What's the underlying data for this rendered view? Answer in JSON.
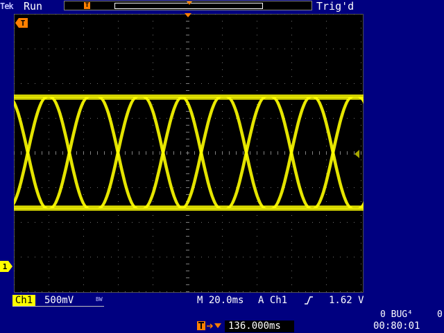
{
  "header": {
    "brand": "Tek",
    "run_state": "Run",
    "trigger_state": "Trig'd",
    "record_trigger_mark": "T"
  },
  "screen": {
    "trigger_marker": "T"
  },
  "channel": {
    "label": "Ch1",
    "ground_marker": "1",
    "scale": "500mV",
    "bandwidth_limit": "BW",
    "color": "#ffff00"
  },
  "horizontal": {
    "timebase": "M 20.0ms",
    "delay": "136.000ms"
  },
  "trigger": {
    "prefix": "A",
    "source": "Ch1",
    "level": "1.62 V"
  },
  "status": {
    "line1": "0 BUG⁴",
    "line1_right": "0",
    "clock": "00:80:01"
  },
  "colors": {
    "background": "#000080",
    "screen": "#000000",
    "trace": "#ffff00",
    "marker": "#ff7f00"
  },
  "waveform": {
    "type": "eye-diagram",
    "high_level_div": 1.6,
    "low_level_div": -1.6,
    "crossings_div": [
      -5.8,
      -4.6,
      -3.4,
      -2.0,
      -0.7,
      0.4,
      1.7,
      3.0,
      4.2,
      5.5
    ],
    "slope_div": 0.55
  }
}
